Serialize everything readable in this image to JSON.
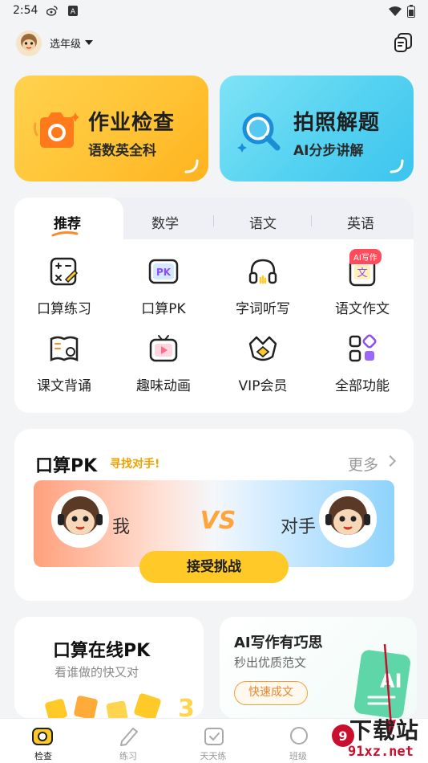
{
  "status_bar": {
    "time": "2:54"
  },
  "header": {
    "grade_selector": "选年级"
  },
  "hero_cards": [
    {
      "title": "作业检查",
      "subtitle": "语数英全科"
    },
    {
      "title": "拍照解题",
      "subtitle": "AI分步讲解"
    }
  ],
  "tabs": [
    "推荐",
    "数学",
    "语文",
    "英语"
  ],
  "features": [
    {
      "label": "口算练习",
      "icon": "calc-practice-icon"
    },
    {
      "label": "口算PK",
      "icon": "pk-icon"
    },
    {
      "label": "字词听写",
      "icon": "headphones-icon"
    },
    {
      "label": "语文作文",
      "icon": "composition-icon"
    },
    {
      "label": "课文背诵",
      "icon": "recite-book-icon"
    },
    {
      "label": "趣味动画",
      "icon": "animation-tv-icon"
    },
    {
      "label": "VIP会员",
      "icon": "vip-crown-icon"
    },
    {
      "label": "全部功能",
      "icon": "all-features-icon"
    }
  ],
  "ai_badge": "AI写作",
  "pk_section": {
    "title": "口算PK",
    "tag": "寻找对手!",
    "more": "更多",
    "me": "我",
    "opponent": "对手",
    "accept_button": "接受挑战"
  },
  "bottom_cards": {
    "left": {
      "title": "口算在线PK",
      "subtitle": "看谁做的快又对"
    },
    "right": {
      "title": "AI写作有巧思",
      "subtitle": "秒出优质范文",
      "button": "快速成文"
    }
  },
  "bottom_nav": [
    {
      "label": "检查",
      "active": true
    },
    {
      "label": "练习",
      "active": false
    },
    {
      "label": "天天练",
      "active": false
    },
    {
      "label": "班级",
      "active": false
    }
  ],
  "watermark": {
    "text": "下载站",
    "url": "91xz.net"
  },
  "colors": {
    "yellow": "#ffc928",
    "cyan": "#55d2f1",
    "badge_red": "#ff4b5c",
    "tag_orange": "#f2a000"
  }
}
